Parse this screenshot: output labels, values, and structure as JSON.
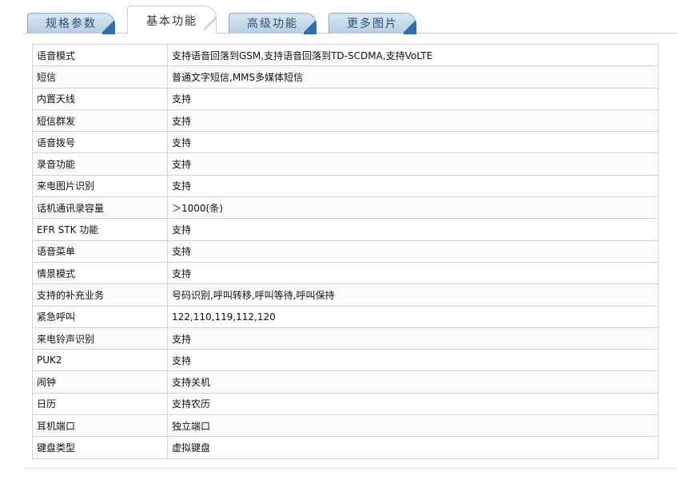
{
  "tabs": [
    {
      "label": "规格参数",
      "active": false
    },
    {
      "label": "基本功能",
      "active": true
    },
    {
      "label": "高级功能",
      "active": false
    },
    {
      "label": "更多图片",
      "active": false
    }
  ],
  "specs": [
    {
      "name": "语音模式",
      "value": "支持语音回落到GSM,支持语音回落到TD-SCDMA,支持VoLTE"
    },
    {
      "name": "短信",
      "value": "普通文字短信,MMS多媒体短信"
    },
    {
      "name": "内置天线",
      "value": "支持"
    },
    {
      "name": "短信群发",
      "value": "支持"
    },
    {
      "name": "语音拨号",
      "value": "支持"
    },
    {
      "name": "录音功能",
      "value": "支持"
    },
    {
      "name": "来电图片识别",
      "value": "支持"
    },
    {
      "name": "话机通讯录容量",
      "value": "＞1000(条)"
    },
    {
      "name": "EFR STK 功能",
      "value": "支持"
    },
    {
      "name": "语音菜单",
      "value": "支持"
    },
    {
      "name": "情景模式",
      "value": "支持"
    },
    {
      "name": "支持的补充业务",
      "value": "号码识别,呼叫转移,呼叫等待,呼叫保持"
    },
    {
      "name": "紧急呼叫",
      "value": "122,110,119,112,120"
    },
    {
      "name": "来电铃声识别",
      "value": "支持"
    },
    {
      "name": "PUK2",
      "value": "支持"
    },
    {
      "name": "闹钟",
      "value": "支持关机"
    },
    {
      "name": "日历",
      "value": "支持农历"
    },
    {
      "name": "耳机端口",
      "value": "独立端口"
    },
    {
      "name": "键盘类型",
      "value": "虚拟键盘"
    }
  ],
  "colors": {
    "tab_active_text": "#333333",
    "tab_inactive_text": "#2b4d78",
    "tab_inactive_bg": "#c9dbec",
    "tab_corner_accent": "#2f6fb0",
    "table_border": "#d3d3d3"
  }
}
